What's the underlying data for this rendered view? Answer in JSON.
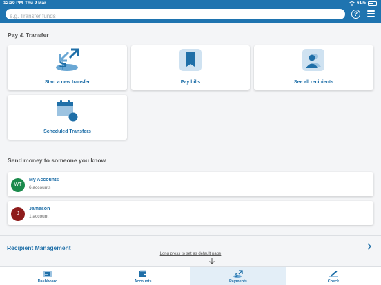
{
  "status_bar": {
    "time": "12:30 PM",
    "date": "Thu 9 Mar",
    "battery": "61%"
  },
  "search": {
    "placeholder": "e.g. Transfer funds"
  },
  "header": {
    "help_icon": "help-icon",
    "menu_icon": "hamburger-menu-icon"
  },
  "pay_transfer": {
    "title": "Pay & Transfer",
    "tiles": [
      {
        "label": "Start a new transfer",
        "icon": "transfer-icon"
      },
      {
        "label": "Pay bills",
        "icon": "bill-receipt-icon"
      },
      {
        "label": "See all recipients",
        "icon": "recipients-icon"
      },
      {
        "label": "Scheduled Transfers",
        "icon": "calendar-icon"
      }
    ]
  },
  "send_money": {
    "title": "Send money to someone you know",
    "rows": [
      {
        "initials": "WT",
        "name": "My Accounts",
        "sub": "6 accounts",
        "color": "#1b8a4c"
      },
      {
        "initials": "J",
        "name": "Jameson",
        "sub": "1 account",
        "color": "#8e1c1c"
      }
    ]
  },
  "recipient_management": {
    "label": "Recipient Management"
  },
  "long_press": {
    "text": "Long press to set as default page"
  },
  "tabs": [
    {
      "label": "Dashboard",
      "icon": "dashboard-icon",
      "active": false
    },
    {
      "label": "Accounts",
      "icon": "accounts-icon",
      "active": false
    },
    {
      "label": "Payments",
      "icon": "payments-icon",
      "active": true
    },
    {
      "label": "Check",
      "icon": "check-icon",
      "active": false
    }
  ],
  "colors": {
    "brand": "#1f74b0",
    "link": "#1f6fa8",
    "active_tab": "#e3eef7"
  }
}
